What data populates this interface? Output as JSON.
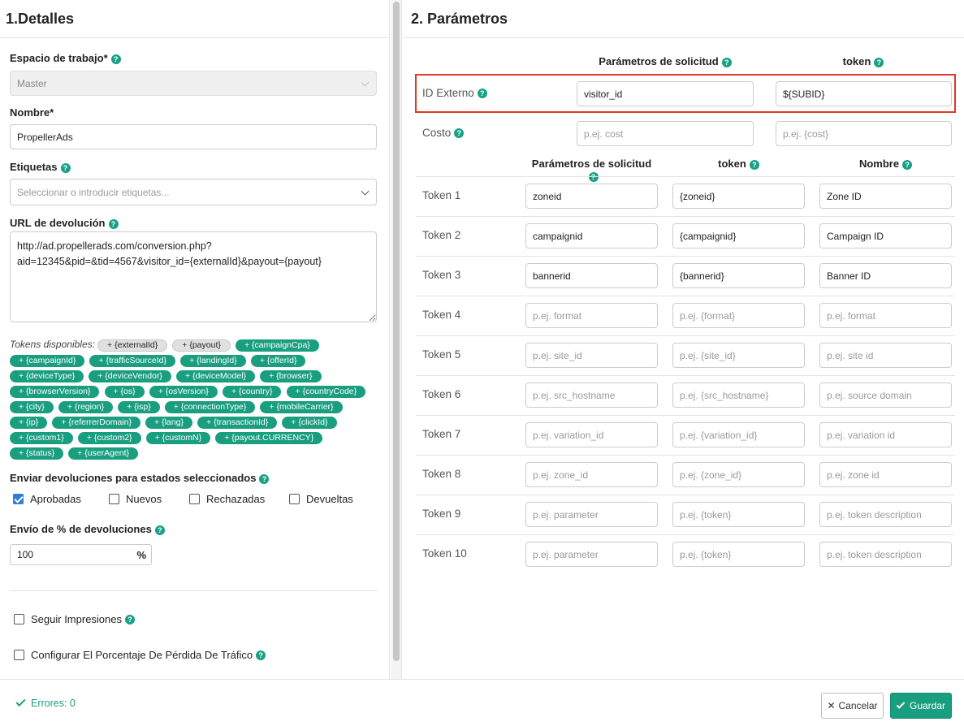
{
  "left": {
    "title": "1.Detalles",
    "workspace": {
      "label": "Espacio de trabajo*",
      "value": "Master"
    },
    "name": {
      "label": "Nombre*",
      "value": "PropellerAds"
    },
    "tags": {
      "label": "Etiquetas",
      "placeholder": "Seleccionar o introducir etiquetas..."
    },
    "postback": {
      "label": "URL de devolución",
      "value": "http://ad.propellerads.com/conversion.php?\naid=12345&pid=&tid=4567&visitor_id={externalId}&payout={payout}"
    },
    "tokens_label": "Tokens disponibles:",
    "tokens": [
      {
        "text": "+ {externalId}",
        "style": "grey"
      },
      {
        "text": "+ {payout}",
        "style": "grey"
      },
      {
        "text": "+ {campaignCpa}",
        "style": "green"
      },
      {
        "text": "+ {campaignId}",
        "style": "green"
      },
      {
        "text": "+ {trafficSourceId}",
        "style": "green"
      },
      {
        "text": "+ {landingId}",
        "style": "green"
      },
      {
        "text": "+ {offerId}",
        "style": "green"
      },
      {
        "text": "+ {deviceType}",
        "style": "green"
      },
      {
        "text": "+ {deviceVendor}",
        "style": "green"
      },
      {
        "text": "+ {deviceModel}",
        "style": "green"
      },
      {
        "text": "+ {browser}",
        "style": "green"
      },
      {
        "text": "+ {browserVersion}",
        "style": "green"
      },
      {
        "text": "+ {os}",
        "style": "green"
      },
      {
        "text": "+ {osVersion}",
        "style": "green"
      },
      {
        "text": "+ {country}",
        "style": "green"
      },
      {
        "text": "+ {countryCode}",
        "style": "green"
      },
      {
        "text": "+ {city}",
        "style": "green"
      },
      {
        "text": "+ {region}",
        "style": "green"
      },
      {
        "text": "+ {isp}",
        "style": "green"
      },
      {
        "text": "+ {connectionType}",
        "style": "green"
      },
      {
        "text": "+ {mobileCarrier}",
        "style": "green"
      },
      {
        "text": "+ {ip}",
        "style": "green"
      },
      {
        "text": "+ {referrerDomain}",
        "style": "green"
      },
      {
        "text": "+ {lang}",
        "style": "green"
      },
      {
        "text": "+ {transactionId}",
        "style": "green"
      },
      {
        "text": "+ {clickId}",
        "style": "green"
      },
      {
        "text": "+ {custom1}",
        "style": "green"
      },
      {
        "text": "+ {custom2}",
        "style": "green"
      },
      {
        "text": "+ {customN}",
        "style": "green"
      },
      {
        "text": "+ {payout.CURRENCY}",
        "style": "green"
      },
      {
        "text": "+ {status}",
        "style": "green"
      },
      {
        "text": "+ {userAgent}",
        "style": "green"
      }
    ],
    "send_label": "Enviar devoluciones para estados seleccionados",
    "statuses": [
      {
        "label": "Aprobadas",
        "checked": true
      },
      {
        "label": "Nuevos",
        "checked": false
      },
      {
        "label": "Rechazadas",
        "checked": false
      },
      {
        "label": "Devueltas",
        "checked": false
      }
    ],
    "percent": {
      "label": "Envío de % de devoluciones",
      "value": "100",
      "symbol": "%"
    },
    "track_impressions": "Seguir Impresiones",
    "traffic_loss": "Configurar El Porcentaje De Pérdida De Tráfico"
  },
  "right": {
    "title": "2. Parámetros",
    "top_headers": {
      "param": "Parámetros de solicitud",
      "token": "token"
    },
    "external_id": {
      "label": "ID Externo",
      "param": "visitor_id",
      "token": "${SUBID}"
    },
    "cost": {
      "label": "Costo",
      "param_placeholder": "p.ej. cost",
      "token_placeholder": "p.ej. {cost}"
    },
    "token_headers": {
      "param": "Parámetros de solicitud",
      "token": "token",
      "name": "Nombre"
    },
    "tokens": [
      {
        "label": "Token 1",
        "param": "zoneid",
        "token": "{zoneid}",
        "name": "Zone ID",
        "filled": true
      },
      {
        "label": "Token 2",
        "param": "campaignid",
        "token": "{campaignid}",
        "name": "Campaign ID",
        "filled": true
      },
      {
        "label": "Token 3",
        "param": "bannerid",
        "token": "{bannerid}",
        "name": "Banner ID",
        "filled": true
      },
      {
        "label": "Token 4",
        "param": "p.ej. format",
        "token": "p.ej. {format}",
        "name": "p.ej. format",
        "filled": false
      },
      {
        "label": "Token 5",
        "param": "p.ej. site_id",
        "token": "p.ej. {site_id}",
        "name": "p.ej. site id",
        "filled": false
      },
      {
        "label": "Token 6",
        "param": "p.ej. src_hostname",
        "token": "p.ej.  {src_hostname}",
        "name": "p.ej. source domain",
        "filled": false
      },
      {
        "label": "Token 7",
        "param": "p.ej. variation_id",
        "token": "p.ej. {variation_id}",
        "name": "p.ej. variation id",
        "filled": false
      },
      {
        "label": "Token 8",
        "param": "p.ej. zone_id",
        "token": "p.ej. {zone_id}",
        "name": "p.ej. zone id",
        "filled": false
      },
      {
        "label": "Token 9",
        "param": "p.ej. parameter",
        "token": "p.ej. {token}",
        "name": "p.ej. token description",
        "filled": false
      },
      {
        "label": "Token 10",
        "param": "p.ej. parameter",
        "token": "p.ej. {token}",
        "name": "p.ej. token description",
        "filled": false
      }
    ]
  },
  "footer": {
    "errors": "Errores: 0",
    "cancel": "Cancelar",
    "save": "Guardar"
  },
  "colors": {
    "accent": "#1a9e80",
    "highlight": "#e2382c",
    "checkbox": "#2e7dd7"
  },
  "help_icon": "?"
}
